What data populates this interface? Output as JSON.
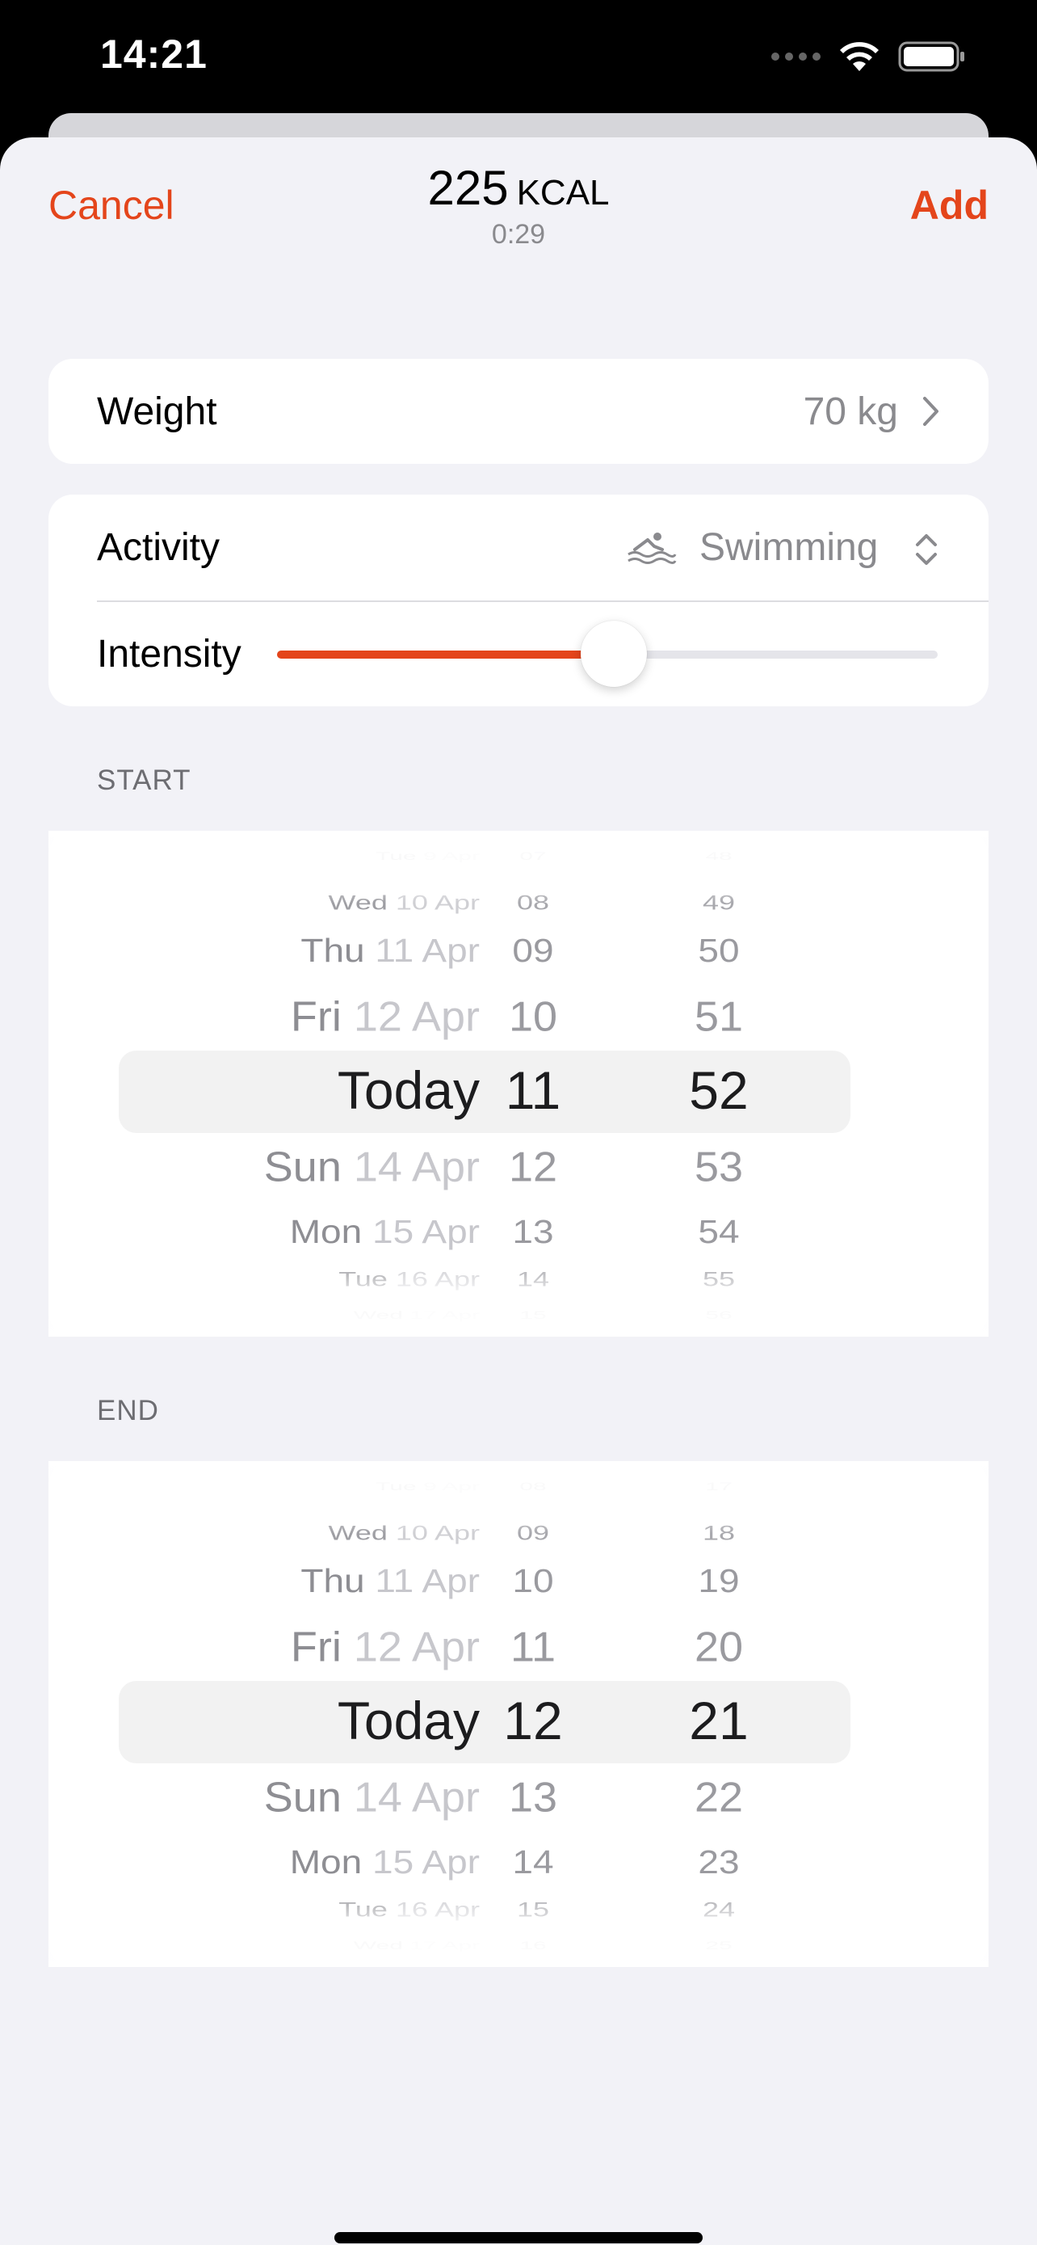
{
  "status_bar": {
    "time": "14:21"
  },
  "nav": {
    "cancel_label": "Cancel",
    "add_label": "Add",
    "calories": "225",
    "calories_unit": "KCAL",
    "duration": "0:29"
  },
  "weight": {
    "label": "Weight",
    "value": "70 kg"
  },
  "activity": {
    "label": "Activity",
    "value": "Swimming",
    "icon": "swimming-icon"
  },
  "intensity": {
    "label": "Intensity",
    "level": 0.5
  },
  "start": {
    "header": "START",
    "dates": [
      "Tue 9 Apr",
      "Wed 10 Apr",
      "Thu 11 Apr",
      "Fri 12 Apr",
      "Today",
      "Sun 14 Apr",
      "Mon 15 Apr",
      "Tue 16 Apr",
      "Wed 17 Apr"
    ],
    "hours": [
      "07",
      "08",
      "09",
      "10",
      "11",
      "12",
      "13",
      "14",
      "15"
    ],
    "minutes": [
      "48",
      "49",
      "50",
      "51",
      "52",
      "53",
      "54",
      "55",
      "56"
    ]
  },
  "end": {
    "header": "END",
    "dates": [
      "Tue 9 Apr",
      "Wed 10 Apr",
      "Thu 11 Apr",
      "Fri 12 Apr",
      "Today",
      "Sun 14 Apr",
      "Mon 15 Apr",
      "Tue 16 Apr",
      "Wed 17 Apr"
    ],
    "hours": [
      "08",
      "09",
      "10",
      "11",
      "12",
      "13",
      "14",
      "15",
      "16"
    ],
    "minutes": [
      "17",
      "18",
      "19",
      "20",
      "21",
      "22",
      "23",
      "24",
      "25"
    ]
  },
  "colors": {
    "accent": "#e4451b",
    "background": "#f2f2f7",
    "secondary_text": "#8a8a8e"
  }
}
